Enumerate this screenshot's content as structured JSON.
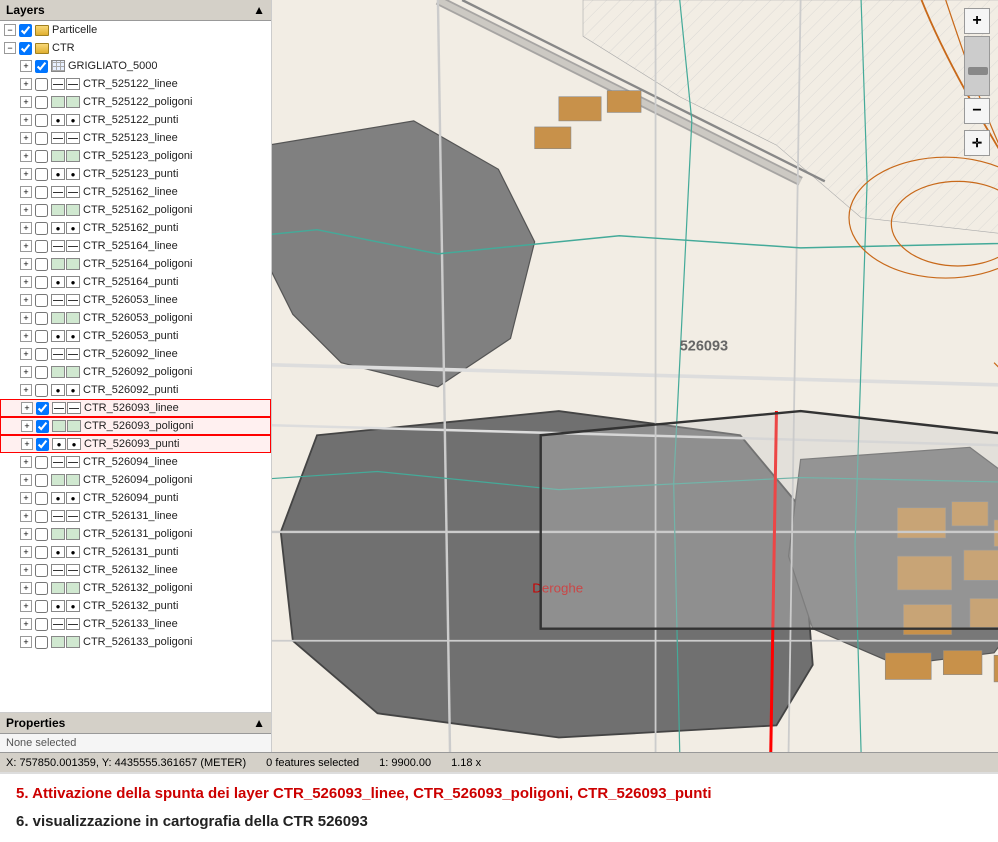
{
  "layers_panel": {
    "title": "Layers",
    "items": [
      {
        "id": "particelle",
        "name": "Particelle",
        "level": 1,
        "type": "group",
        "checked": true,
        "expanded": true
      },
      {
        "id": "ctr",
        "name": "CTR",
        "level": 1,
        "type": "group",
        "checked": true,
        "expanded": true
      },
      {
        "id": "grigliato",
        "name": "GRIGLIATO_5000",
        "level": 2,
        "type": "grid",
        "checked": true,
        "expanded": false
      },
      {
        "id": "l525122_l",
        "name": "CTR_525122_linee",
        "level": 2,
        "type": "line",
        "checked": false,
        "expanded": false
      },
      {
        "id": "l525122_p",
        "name": "CTR_525122_poligoni",
        "level": 2,
        "type": "poly",
        "checked": false,
        "expanded": false
      },
      {
        "id": "l525122_pt",
        "name": "CTR_525122_punti",
        "level": 2,
        "type": "point",
        "checked": false,
        "expanded": false
      },
      {
        "id": "l525123_l",
        "name": "CTR_525123_linee",
        "level": 2,
        "type": "line",
        "checked": false,
        "expanded": false
      },
      {
        "id": "l525123_p",
        "name": "CTR_525123_poligoni",
        "level": 2,
        "type": "poly",
        "checked": false,
        "expanded": false
      },
      {
        "id": "l525123_pt",
        "name": "CTR_525123_punti",
        "level": 2,
        "type": "point",
        "checked": false,
        "expanded": false
      },
      {
        "id": "l525162_l",
        "name": "CTR_525162_linee",
        "level": 2,
        "type": "line",
        "checked": false,
        "expanded": false
      },
      {
        "id": "l525162_p",
        "name": "CTR_525162_poligoni",
        "level": 2,
        "type": "poly",
        "checked": false,
        "expanded": false
      },
      {
        "id": "l525162_pt",
        "name": "CTR_525162_punti",
        "level": 2,
        "type": "point",
        "checked": false,
        "expanded": false
      },
      {
        "id": "l525164_l",
        "name": "CTR_525164_linee",
        "level": 2,
        "type": "line",
        "checked": false,
        "expanded": false
      },
      {
        "id": "l525164_p",
        "name": "CTR_525164_poligoni",
        "level": 2,
        "type": "poly",
        "checked": false,
        "expanded": false
      },
      {
        "id": "l525164_pt",
        "name": "CTR_525164_punti",
        "level": 2,
        "type": "point",
        "checked": false,
        "expanded": false
      },
      {
        "id": "l526053_l",
        "name": "CTR_526053_linee",
        "level": 2,
        "type": "line",
        "checked": false,
        "expanded": false
      },
      {
        "id": "l526053_p",
        "name": "CTR_526053_poligoni",
        "level": 2,
        "type": "poly",
        "checked": false,
        "expanded": false
      },
      {
        "id": "l526053_pt",
        "name": "CTR_526053_punti",
        "level": 2,
        "type": "point",
        "checked": false,
        "expanded": false
      },
      {
        "id": "l526092_l",
        "name": "CTR_526092_linee",
        "level": 2,
        "type": "line",
        "checked": false,
        "expanded": false
      },
      {
        "id": "l526092_p",
        "name": "CTR_526092_poligoni",
        "level": 2,
        "type": "poly",
        "checked": false,
        "expanded": false
      },
      {
        "id": "l526092_pt",
        "name": "CTR_526092_punti",
        "level": 2,
        "type": "point",
        "checked": false,
        "expanded": false
      },
      {
        "id": "l526093_l",
        "name": "CTR_526093_linee",
        "level": 2,
        "type": "line",
        "checked": true,
        "expanded": false,
        "highlighted": true
      },
      {
        "id": "l526093_p",
        "name": "CTR_526093_poligoni",
        "level": 2,
        "type": "poly",
        "checked": true,
        "expanded": false,
        "highlighted": true
      },
      {
        "id": "l526093_pt",
        "name": "CTR_526093_punti",
        "level": 2,
        "type": "point",
        "checked": true,
        "expanded": false,
        "highlighted": true
      },
      {
        "id": "l526094_l",
        "name": "CTR_526094_linee",
        "level": 2,
        "type": "line",
        "checked": false,
        "expanded": false
      },
      {
        "id": "l526094_p",
        "name": "CTR_526094_poligoni",
        "level": 2,
        "type": "poly",
        "checked": false,
        "expanded": false
      },
      {
        "id": "l526094_pt",
        "name": "CTR_526094_punti",
        "level": 2,
        "type": "point",
        "checked": false,
        "expanded": false
      },
      {
        "id": "l526131_l",
        "name": "CTR_526131_linee",
        "level": 2,
        "type": "line",
        "checked": false,
        "expanded": false
      },
      {
        "id": "l526131_p",
        "name": "CTR_526131_poligoni",
        "level": 2,
        "type": "poly",
        "checked": false,
        "expanded": false
      },
      {
        "id": "l526131_pt",
        "name": "CTR_526131_punti",
        "level": 2,
        "type": "point",
        "checked": false,
        "expanded": false
      },
      {
        "id": "l526132_l",
        "name": "CTR_526132_linee",
        "level": 2,
        "type": "line",
        "checked": false,
        "expanded": false
      },
      {
        "id": "l526132_p",
        "name": "CTR_526132_poligoni",
        "level": 2,
        "type": "poly",
        "checked": false,
        "expanded": false
      },
      {
        "id": "l526132_pt",
        "name": "CTR_526132_punti",
        "level": 2,
        "type": "point",
        "checked": false,
        "expanded": false
      },
      {
        "id": "l526133_l",
        "name": "CTR_526133_linee",
        "level": 2,
        "type": "line",
        "checked": false,
        "expanded": false
      },
      {
        "id": "l526133_p",
        "name": "CTR_526133_poligoni",
        "level": 2,
        "type": "poly",
        "checked": false,
        "expanded": false
      }
    ]
  },
  "properties_panel": {
    "title": "Properties",
    "content": "None selected"
  },
  "status_bar": {
    "coordinates": "X: 757850.001359, Y: 4435555.361657 (METER)",
    "features_selected": "0 features selected",
    "scale": "1: 9900.00",
    "zoom": "1.18 x"
  },
  "annotations": {
    "step5": "5. Attivazione della spunta dei layer CTR_526093_linee, CTR_526093_poligoni, CTR_526093_punti",
    "step6": "6. visualizzazione in cartografia della CTR 526093"
  },
  "map": {
    "tile_labels": [
      "526093",
      "526093"
    ],
    "deroghe_label": "Deroghe",
    "zoom_in": "+",
    "zoom_out": "−"
  }
}
